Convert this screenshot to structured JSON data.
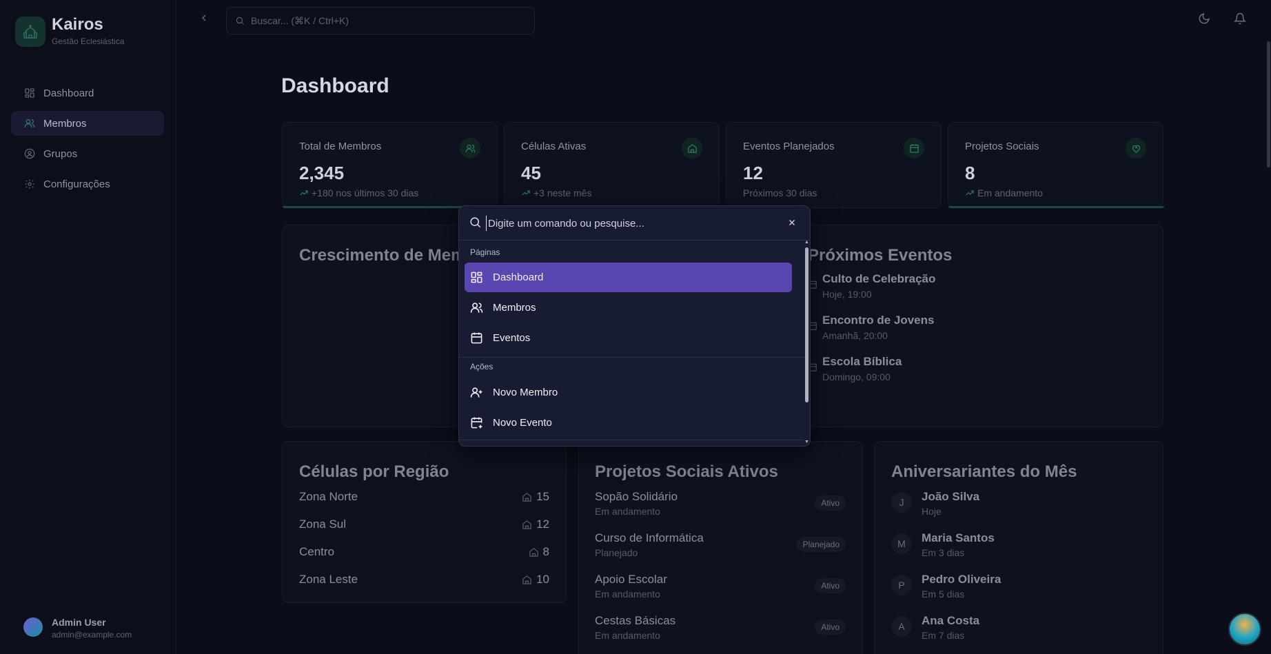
{
  "brand": {
    "name": "Kairos",
    "subtitle": "Gestão Eclesiástica"
  },
  "sidebar": {
    "items": [
      {
        "label": "Dashboard",
        "icon": "layout-grid-icon",
        "active": false
      },
      {
        "label": "Membros",
        "icon": "users-icon",
        "active": true
      },
      {
        "label": "Grupos",
        "icon": "user-circle-icon",
        "active": false
      },
      {
        "label": "Configurações",
        "icon": "gear-icon",
        "active": false
      }
    ],
    "user": {
      "name": "Admin User",
      "email": "admin@example.com"
    }
  },
  "topbar": {
    "search_placeholder": "Buscar... (⌘K / Ctrl+K)"
  },
  "page": {
    "title": "Dashboard"
  },
  "stats": [
    {
      "title": "Total de Membros",
      "value": "2,345",
      "sub": "+180 nos últimos 30 dias",
      "icon": "users-icon",
      "trend": true
    },
    {
      "title": "Células Ativas",
      "value": "45",
      "sub": "+3 neste mês",
      "icon": "home-icon",
      "trend": true
    },
    {
      "title": "Eventos Planejados",
      "value": "12",
      "sub": "Próximos 30 dias",
      "icon": "calendar-icon",
      "trend": false
    },
    {
      "title": "Projetos Sociais",
      "value": "8",
      "sub": "Em andamento",
      "icon": "heart-handshake-icon",
      "trend": true
    }
  ],
  "growth": {
    "title": "Crescimento de Membros"
  },
  "events": {
    "title": "Próximos Eventos",
    "items": [
      {
        "name": "Culto de Celebração",
        "when": "Hoje, 19:00"
      },
      {
        "name": "Encontro de Jovens",
        "when": "Amanhã, 20:00"
      },
      {
        "name": "Escola Bíblica",
        "when": "Domingo, 09:00"
      }
    ]
  },
  "regions": {
    "title": "Células por Região",
    "items": [
      {
        "name": "Zona Norte",
        "count": "15"
      },
      {
        "name": "Zona Sul",
        "count": "12"
      },
      {
        "name": "Centro",
        "count": "8"
      },
      {
        "name": "Zona Leste",
        "count": "10"
      }
    ]
  },
  "projects": {
    "title": "Projetos Sociais Ativos",
    "items": [
      {
        "name": "Sopão Solidário",
        "status_text": "Em andamento",
        "badge": "Ativo"
      },
      {
        "name": "Curso de Informática",
        "status_text": "Planejado",
        "badge": "Planejado"
      },
      {
        "name": "Apoio Escolar",
        "status_text": "Em andamento",
        "badge": "Ativo"
      },
      {
        "name": "Cestas Básicas",
        "status_text": "Em andamento",
        "badge": "Ativo"
      }
    ]
  },
  "birthdays": {
    "title": "Aniversariantes do Mês",
    "items": [
      {
        "initial": "J",
        "name": "João Silva",
        "when": "Hoje"
      },
      {
        "initial": "M",
        "name": "Maria Santos",
        "when": "Em 3 dias"
      },
      {
        "initial": "P",
        "name": "Pedro Oliveira",
        "when": "Em 5 dias"
      },
      {
        "initial": "A",
        "name": "Ana Costa",
        "when": "Em 7 dias"
      }
    ]
  },
  "palette": {
    "placeholder": "Digite um comando ou pesquise...",
    "groups": [
      {
        "label": "Páginas",
        "items": [
          {
            "label": "Dashboard",
            "icon": "layout-grid-icon",
            "selected": true
          },
          {
            "label": "Membros",
            "icon": "users-icon",
            "selected": false
          },
          {
            "label": "Eventos",
            "icon": "calendar-icon",
            "selected": false
          }
        ]
      },
      {
        "label": "Ações",
        "items": [
          {
            "label": "Novo Membro",
            "icon": "user-plus-icon",
            "selected": false
          },
          {
            "label": "Novo Evento",
            "icon": "calendar-plus-icon",
            "selected": false
          }
        ]
      }
    ]
  },
  "colors": {
    "accent": "#5a46b0",
    "teal": "#1d4945",
    "background": "#0b0e19"
  }
}
